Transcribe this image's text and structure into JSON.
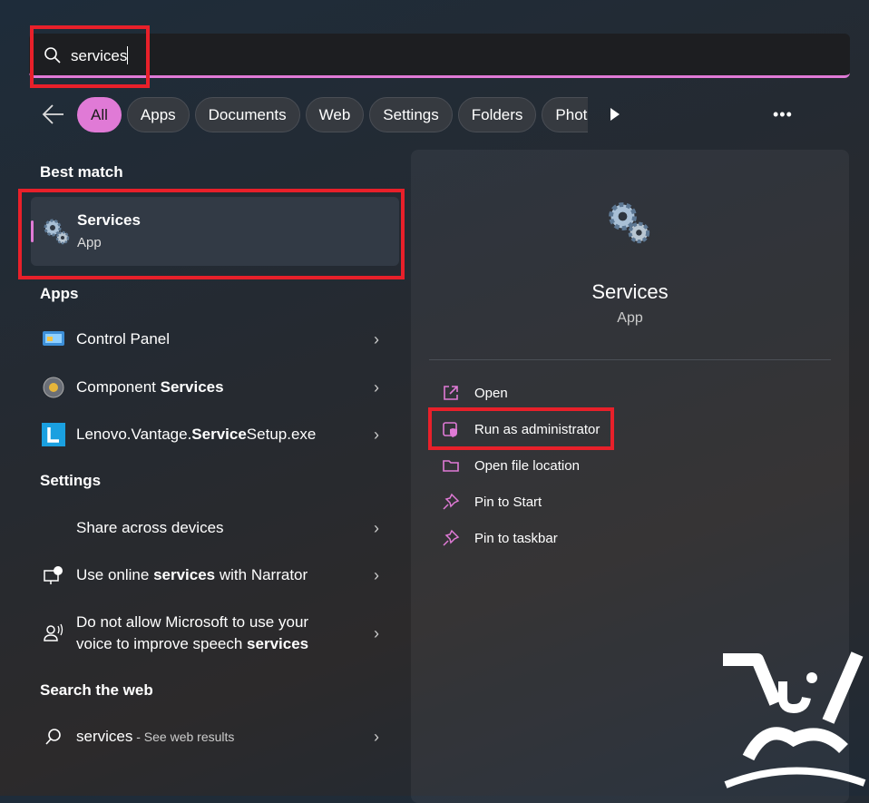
{
  "search": {
    "query": "services",
    "icon": "search-icon"
  },
  "filters": {
    "items": [
      "All",
      "Apps",
      "Documents",
      "Web",
      "Settings",
      "Folders",
      "Photos"
    ],
    "active": "All",
    "more_label": "•••"
  },
  "best_match": {
    "heading": "Best match",
    "title": "Services",
    "subtitle": "App",
    "icon": "gears-icon"
  },
  "apps": {
    "heading": "Apps",
    "items": [
      {
        "parts": [
          {
            "t": "Control Panel",
            "b": false
          }
        ],
        "icon": "control-panel-icon"
      },
      {
        "parts": [
          {
            "t": "Component ",
            "b": false
          },
          {
            "t": "Services",
            "b": true
          }
        ],
        "icon": "component-services-icon"
      },
      {
        "parts": [
          {
            "t": "Lenovo.Vantage.",
            "b": false
          },
          {
            "t": "Service",
            "b": true
          },
          {
            "t": "Setup.exe",
            "b": false
          }
        ],
        "icon": "lenovo-vantage-icon"
      }
    ]
  },
  "settings": {
    "heading": "Settings",
    "items": [
      {
        "parts": [
          {
            "t": "Share across devices",
            "b": false
          }
        ]
      },
      {
        "parts": [
          {
            "t": "Use online ",
            "b": false
          },
          {
            "t": "services",
            "b": true
          },
          {
            "t": " with Narrator",
            "b": false
          }
        ],
        "icon": "narrator-icon"
      },
      {
        "parts": [
          {
            "t": "Do not allow Microsoft to use your voice to improve speech ",
            "b": false
          },
          {
            "t": "services",
            "b": true
          }
        ],
        "icon": "voice-icon"
      }
    ]
  },
  "web": {
    "heading": "Search the web",
    "query": "services",
    "suffix": " - See web results"
  },
  "preview": {
    "title": "Services",
    "subtitle": "App",
    "actions": [
      "Open",
      "Run as administrator",
      "Open file location",
      "Pin to Start",
      "Pin to taskbar"
    ]
  },
  "colors": {
    "accent": "#e07ad6",
    "highlight": "#e8202a"
  }
}
